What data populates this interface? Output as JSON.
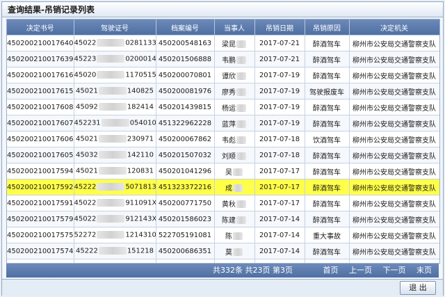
{
  "window": {
    "title": "查询结果-吊销记录列表"
  },
  "columns": [
    "决定书号",
    "驾驶证号",
    "档案编号",
    "当事人",
    "吊销日期",
    "吊销原因",
    "决定机关"
  ],
  "rows": [
    {
      "doc_no": "450200210017640",
      "lic_pre": "45022",
      "lic_suf": "0281133",
      "file_no": "450200548163",
      "party": "梁昆",
      "date": "2017-07-21",
      "reason": "醉酒驾车",
      "authority": "柳州市公安局交通警察支队"
    },
    {
      "doc_no": "450200210017639",
      "lic_pre": "45223",
      "lic_suf": "0200014",
      "file_no": "450201506888",
      "party": "韦鹏",
      "date": "2017-07-21",
      "reason": "醉酒驾车",
      "authority": "柳州市公安局交通警察支队"
    },
    {
      "doc_no": "450200210017616",
      "lic_pre": "45020",
      "lic_suf": "1170515",
      "file_no": "450200070801",
      "party": "谭欣",
      "date": "2017-07-19",
      "reason": "醉酒驾车",
      "authority": "柳州市公安局交通警察支队"
    },
    {
      "doc_no": "450200210017615",
      "lic_pre": "45021",
      "lic_suf": "140825",
      "file_no": "450200081976",
      "party": "廖秀",
      "date": "2017-07-19",
      "reason": "驾驶报废车",
      "authority": "柳州市公安局交通警察支队"
    },
    {
      "doc_no": "450200210017608",
      "lic_pre": "45092",
      "lic_suf": "182414",
      "file_no": "450201439815",
      "party": "杨运",
      "date": "2017-07-19",
      "reason": "醉酒驾车",
      "authority": "柳州市公安局交通警察支队"
    },
    {
      "doc_no": "450200210017607",
      "lic_pre": "452231",
      "lic_suf": "054010",
      "file_no": "451322962228",
      "party": "蓝萍",
      "date": "2017-07-19",
      "reason": "醉酒驾车",
      "authority": "柳州市公安局交通警察支队"
    },
    {
      "doc_no": "450200210017606",
      "lic_pre": "45021",
      "lic_suf": "230971",
      "file_no": "450200067862",
      "party": "韦彪",
      "date": "2017-07-18",
      "reason": "饮酒驾车",
      "authority": "柳州市公安局交通警察支队"
    },
    {
      "doc_no": "450200210017605",
      "lic_pre": "45032",
      "lic_suf": "142110",
      "file_no": "450201507032",
      "party": "刘顺",
      "date": "2017-07-18",
      "reason": "醉酒驾车",
      "authority": "柳州市公安局交通警察支队"
    },
    {
      "doc_no": "450200210017594",
      "lic_pre": "45021",
      "lic_suf": "120831",
      "file_no": "450201041296",
      "party": "吴",
      "date": "2017-07-17",
      "reason": "醉酒驾车",
      "authority": "柳州市公安局交通警察支队"
    },
    {
      "doc_no": "450200210017592",
      "lic_pre": "45222",
      "lic_suf": "5071813",
      "file_no": "451323372216",
      "party": "成",
      "date": "2017-07-17",
      "reason": "醉酒驾车",
      "authority": "柳州市公安局交通警察支队"
    },
    {
      "doc_no": "450200210017591",
      "lic_pre": "45022",
      "lic_suf": "911091X",
      "file_no": "450200771750",
      "party": "黄秋",
      "date": "2017-07-17",
      "reason": "醉酒驾车",
      "authority": "柳州市公安局交通警察支队"
    },
    {
      "doc_no": "450200210017579",
      "lic_pre": "45022",
      "lic_suf": "912143X",
      "file_no": "450201586023",
      "party": "陈建",
      "date": "2017-07-14",
      "reason": "醉酒驾车",
      "authority": "柳州市公安局交通警察支队"
    },
    {
      "doc_no": "450200210017575",
      "lic_pre": "52272",
      "lic_suf": "1214310",
      "file_no": "522705191081",
      "party": "陈",
      "date": "2017-07-14",
      "reason": "重大事故",
      "authority": "柳州市公安局交通警察支队"
    },
    {
      "doc_no": "450200210017574",
      "lic_pre": "45222",
      "lic_suf": "151218",
      "file_no": "450200686351",
      "party": "莫",
      "date": "2017-07-14",
      "reason": "醉酒驾车",
      "authority": "柳州市公安局交通警察支队"
    },
    {
      "doc_no": "450200210017567",
      "lic_pre": "45250",
      "lic_suf": "2254110",
      "file_no": "451322299974",
      "party": "谭",
      "date": "2017-07-14",
      "reason": "其他",
      "authority": "柳州市公安局交通警察支队"
    }
  ],
  "selected_row": 9,
  "status": {
    "summary": "共332条   共23页   第3页",
    "first": "首页",
    "prev": "上一页",
    "next": "下一页",
    "last": "末页"
  },
  "footer": {
    "exit_label": "退 出"
  },
  "colors": {
    "header_bg": "#5a79ad",
    "selected_row": "#ffff4a",
    "border": "#9bb0cc"
  }
}
